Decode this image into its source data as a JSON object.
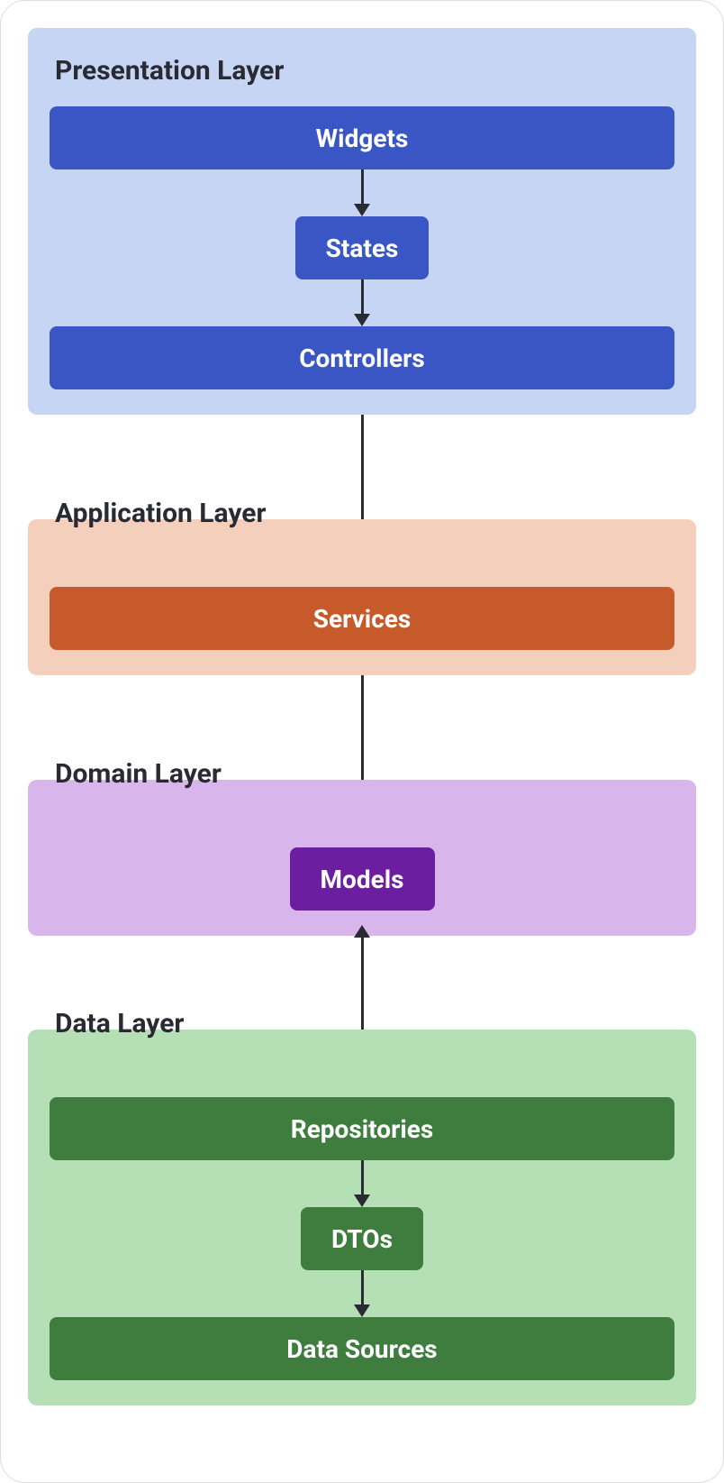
{
  "layers": {
    "presentation": {
      "title": "Presentation Layer",
      "boxes": {
        "widgets": "Widgets",
        "states": "States",
        "controllers": "Controllers"
      }
    },
    "application": {
      "title": "Application Layer",
      "boxes": {
        "services": "Services"
      }
    },
    "domain": {
      "title": "Domain Layer",
      "boxes": {
        "models": "Models"
      }
    },
    "data": {
      "title": "Data Layer",
      "boxes": {
        "repositories": "Repositories",
        "dtos": "DTOs",
        "sources": "Data Sources"
      }
    }
  },
  "colors": {
    "presentation_bg": "#c7d5f4",
    "presentation_box": "#3a56c5",
    "application_bg": "#f4d0bc",
    "application_box": "#c65a2a",
    "domain_bg": "#d8b6ec",
    "domain_box": "#6b1fa0",
    "data_bg": "#b5e0b5",
    "data_box": "#3f7d3f",
    "arrow": "#2a2a33"
  },
  "connections": [
    {
      "from": "widgets",
      "to": "states",
      "direction": "down"
    },
    {
      "from": "states",
      "to": "controllers",
      "direction": "down"
    },
    {
      "from": "controllers",
      "to": "services",
      "direction": "down"
    },
    {
      "from": "services",
      "to": "models",
      "direction": "down"
    },
    {
      "from": "repositories",
      "to": "models",
      "direction": "up"
    },
    {
      "from": "repositories",
      "to": "dtos",
      "direction": "down"
    },
    {
      "from": "dtos",
      "to": "sources",
      "direction": "down"
    }
  ]
}
